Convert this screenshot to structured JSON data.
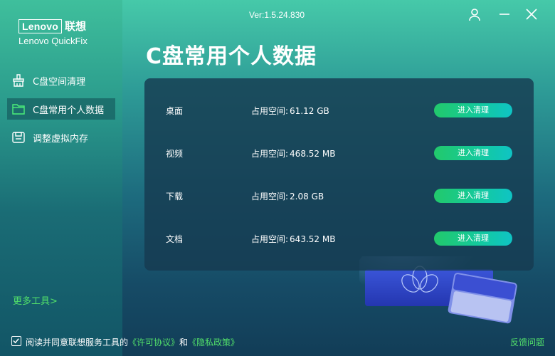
{
  "brand": {
    "logo_text": "Lenovo",
    "logo_cn": "联想",
    "product_name": "Lenovo QuickFix"
  },
  "header": {
    "version": "Ver:1.5.24.830"
  },
  "sidebar": {
    "items": [
      {
        "label": "C盘空间清理",
        "icon": "broom-icon",
        "active": false
      },
      {
        "label": "C盘常用个人数据",
        "icon": "folder-icon",
        "active": true
      },
      {
        "label": "调整虚拟内存",
        "icon": "memory-icon",
        "active": false
      }
    ],
    "more_tools": "更多工具>"
  },
  "main": {
    "title": "C盘常用个人数据",
    "size_label": "占用空间:",
    "button_label": "进入清理",
    "rows": [
      {
        "name": "桌面",
        "size": "61.12 GB"
      },
      {
        "name": "视频",
        "size": "468.52 MB"
      },
      {
        "name": "下载",
        "size": "2.08 GB"
      },
      {
        "name": "文档",
        "size": "643.52 MB"
      }
    ]
  },
  "footer": {
    "agree_prefix": "阅读并同意联想服务工具的",
    "license_link": "《许可协议》",
    "and": "和",
    "privacy_link": "《隐私政策》",
    "feedback": "反馈问题",
    "checked": true
  },
  "colors": {
    "accent_green": "#52e06a",
    "button_start": "#22c96b",
    "button_end": "#0fc4c4",
    "panel_bg": "#163a50"
  }
}
